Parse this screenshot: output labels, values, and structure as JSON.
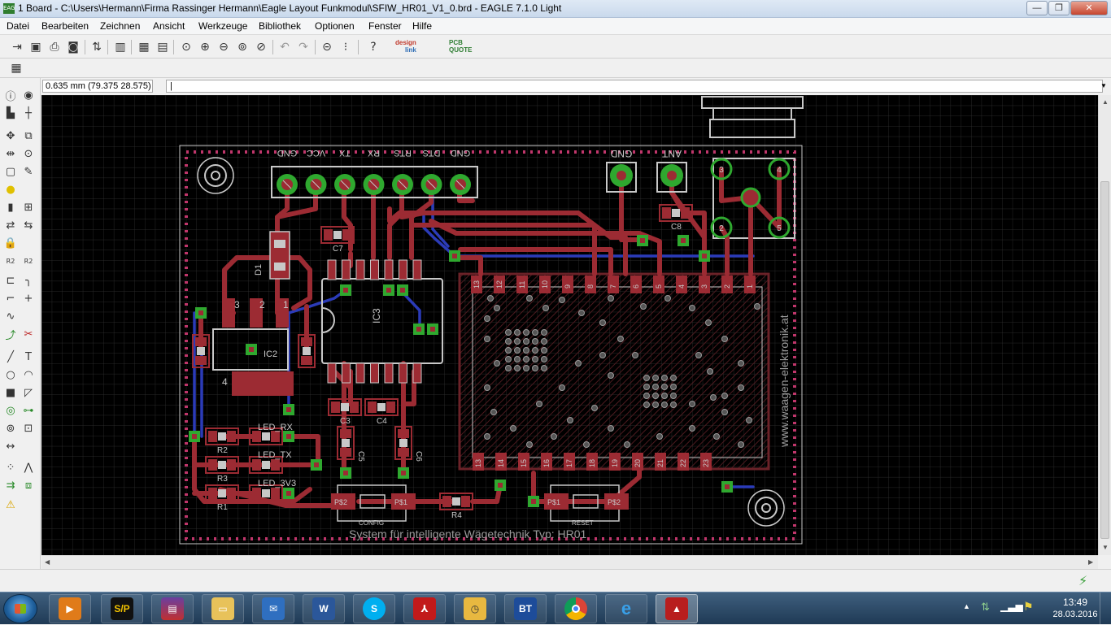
{
  "window": {
    "title": "1 Board - C:\\Users\\Hermann\\Firma Rassinger Hermann\\Eagle Layout Funkmodul\\SFIW_HR01_V1_0.brd - EAGLE 7.1.0 Light",
    "app_icon": "EAG",
    "controls": {
      "minimize": "—",
      "maximize": "❐",
      "close": "✕"
    }
  },
  "menu": [
    "Datei",
    "Bearbeiten",
    "Zeichnen",
    "Ansicht",
    "Werkzeuge",
    "Bibliothek",
    "Optionen",
    "Fenster",
    "Hilfe"
  ],
  "toolbar": {
    "icons": [
      "open-icon",
      "save-icon",
      "print-icon",
      "cam-icon",
      "board-switch-icon",
      "script-icon",
      "ulp-icon",
      "zoom-fit-icon",
      "zoom-in-icon",
      "zoom-out-icon",
      "redraw-icon",
      "zoom-select-icon",
      "undo-icon",
      "redo-icon",
      "stop-icon",
      "go-icon",
      "help-icon"
    ],
    "brand_designlink": [
      "design",
      "link"
    ],
    "brand_pcbquote": [
      "PCB",
      "QUOTE"
    ]
  },
  "command": {
    "coordinates": "0.635 mm (79.375 28.575)",
    "input_value": "|"
  },
  "board": {
    "header_pads": [
      "GND",
      "VCC",
      "TX",
      "RX",
      "RTS",
      "DTS",
      "GND"
    ],
    "ant_labels": [
      "GND",
      "ANT"
    ],
    "ic_labels": [
      "IC2",
      "IC3",
      "D1"
    ],
    "ic2_pins": [
      "3",
      "2",
      "1",
      "4"
    ],
    "module_pins_top": [
      "13",
      "12",
      "11",
      "10",
      "9",
      "8",
      "7",
      "6",
      "5",
      "4",
      "3",
      "2",
      "1"
    ],
    "module_pins_bottom": [
      "13",
      "14",
      "15",
      "16",
      "17",
      "18",
      "19",
      "20",
      "21",
      "22",
      "23"
    ],
    "connector_pins": [
      "3",
      "4",
      "2",
      "5"
    ],
    "components": [
      "C7",
      "C8",
      "C3",
      "C4",
      "C5",
      "C6",
      "R1",
      "R2",
      "R3",
      "R4"
    ],
    "leds": [
      "LED_RX",
      "LED_TX",
      "LED_3V3"
    ],
    "switches": [
      {
        "name": "CONFIG",
        "pads": [
          "P$2",
          "P$1"
        ]
      },
      {
        "name": "RESET",
        "pads": [
          "P$1",
          "P$2"
        ]
      }
    ],
    "caption": "System für intelligente Wägetechnik Typ: HR01",
    "vertical_text": "www.waagen-elektronik.at"
  },
  "colors": {
    "background": "#000000",
    "grid": "#3a3a3a",
    "top_copper": "#9c2b33",
    "bottom_copper": "#2b3bb8",
    "via": "#2fa82f",
    "silkscreen": "#c8c8c8",
    "dimension": "#c8c8c8",
    "keepout_dots": "#c0366b"
  },
  "taskbar": {
    "apps": [
      "media-player-icon",
      "sp-icon",
      "winrar-icon",
      "explorer-folder-icon",
      "outlook-mail-icon",
      "word-icon",
      "skype-icon",
      "acrobat-icon",
      "scheduler-icon",
      "bt-icon",
      "chrome-icon",
      "ie-icon",
      "eagle-icon"
    ],
    "sp_label": "S/P",
    "bt_label": "BT",
    "clock_time": "13:49",
    "clock_date": "28.03.2016"
  }
}
